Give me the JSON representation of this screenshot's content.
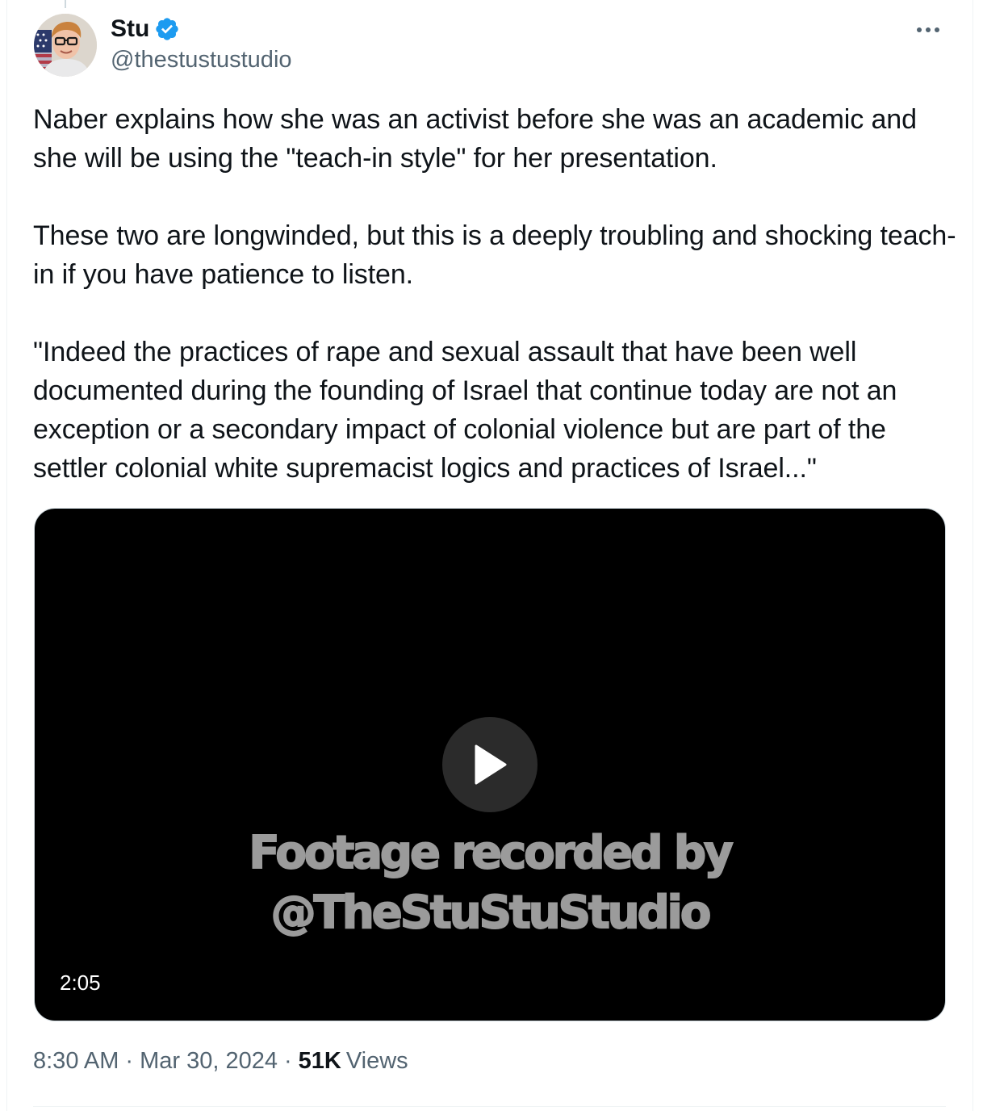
{
  "author": {
    "name": "Stu",
    "handle": "@thestustustudio",
    "verified": true
  },
  "tweet": {
    "text": "Naber explains how she was an activist before she was an academic and she will be using the \"teach-in style\" for her presentation.\n\nThese two are longwinded, but this is a deeply troubling and shocking teach-in if you have patience to listen.\n\n\"Indeed the practices of rape and sexual assault that have been well documented during the founding of Israel that continue today are not an exception or a secondary impact of colonial violence but are part of the settler colonial white supremacist logics and practices of Israel...\""
  },
  "video": {
    "watermark_line1": "Footage recorded by",
    "watermark_line2": "@TheStuStuStudio",
    "duration": "2:05"
  },
  "meta": {
    "time": "8:30 AM",
    "separator": "·",
    "date": "Mar 30, 2024",
    "views_count": "51K",
    "views_label": "Views"
  },
  "icons": {
    "more": "more-horizontal-icon",
    "verified": "verified-badge-icon",
    "play": "play-icon"
  },
  "colors": {
    "text_primary": "#0f1419",
    "text_secondary": "#536471",
    "verified_blue": "#1d9bf0",
    "video_bg": "#000000",
    "watermark": "#9b9b9b"
  }
}
